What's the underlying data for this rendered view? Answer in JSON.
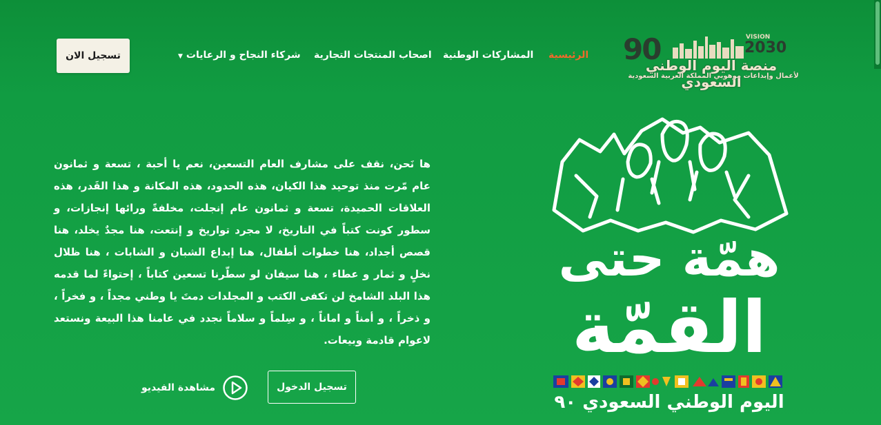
{
  "header": {
    "logo": {
      "number": "90",
      "vision_label": "VISION",
      "vision_year": "2030",
      "title": "منصة اليوم الوطني السعودي",
      "subtitle": "لأعمال وإبداعات موهوبي المملكة العربية السعودية"
    },
    "nav": [
      {
        "label": "الرئيسية",
        "active": true
      },
      {
        "label": "المشاركات الوطنية",
        "active": false
      },
      {
        "label": "اصحاب المنتجات التجارية",
        "active": false
      },
      {
        "label": "شركاء النجاح و الرعايات",
        "active": false,
        "dropdown": true
      }
    ],
    "register_label": "تسجيل الان"
  },
  "hero": {
    "intro": "ها نَحن، نقف على مشارف العام التسعين، نعم يا أحبة ، تسعة و ثمانون عام مّرت منذ توحيد هذا الكيان، هذه الحدود، هذه المكانة و هذا القَدر، هذه العلاقات الحميدة، تسعة و ثمانون عام إنجلت، مخلفةً ورائها إنجازات، و سطور كونت كتباً في التاريخ، لا مجرد تواريخ و إنتعت، هنا مجدٌ يخلد، هنا قصص أجداد، هنا خطوات أطفال، هنا إبداع الشبان و الشابات ، هنا ظلال نخلٍ و ثمار و عطاء ، هنا سيفان لو سطّرنا تسعين كتاباً ، إحتواءً لما قدمه هذا البلد الشامخ لن تكفى الكتب و المجلدات دمتَ يا وطني مجداً ، و فخراً ، و ذخراً ، و أمناً و اماناً ، و سِلماً و سلاماً نجدد في عامنا هذا البيعة ونستعد لاعوام قادمة وبيعات.",
    "login_label": "تسجيل الدخول",
    "video_label": "مشاهدة الفيديو"
  },
  "emblem": {
    "line1": "همّة حتى",
    "line2": "القمّة",
    "national_day": "اليوم الوطني السعودي ٩٠"
  },
  "colors": {
    "background": "#0f9a3f",
    "active_nav": "#f06a2a",
    "button_bg": "#f4f1e6"
  }
}
